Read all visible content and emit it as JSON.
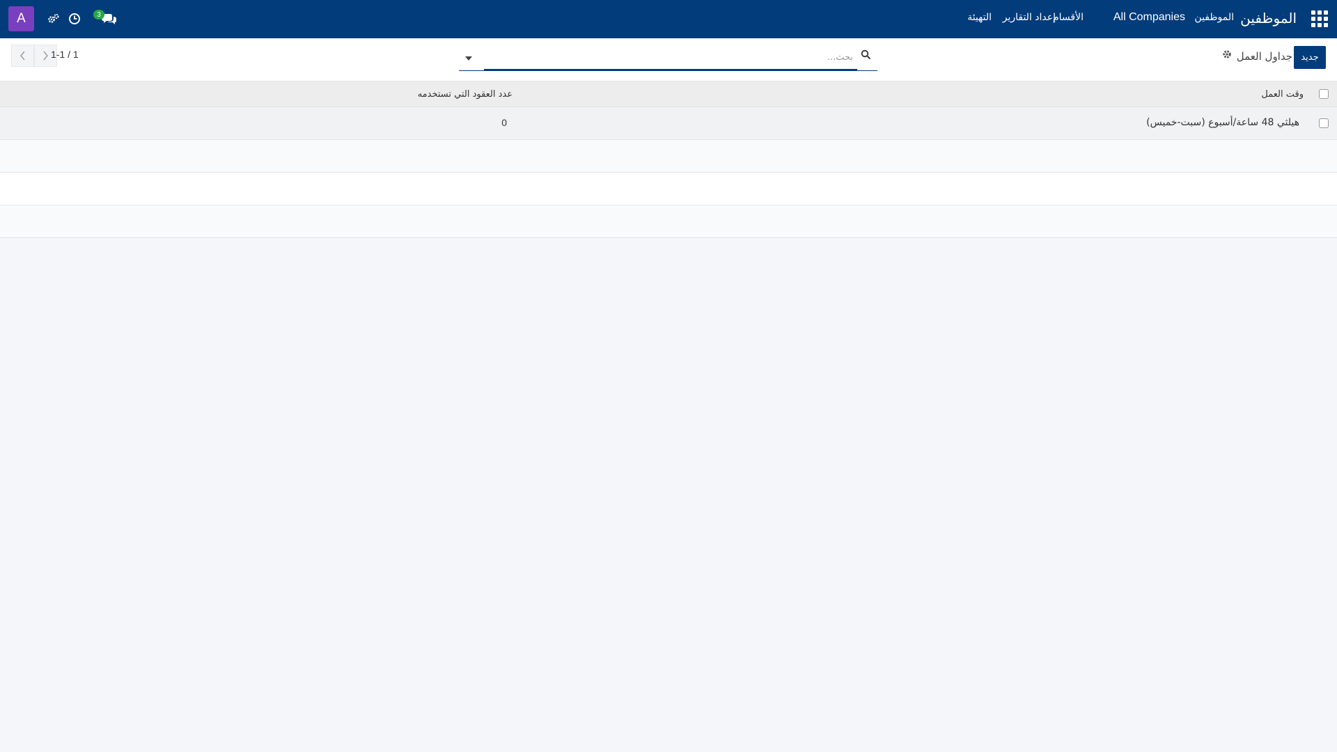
{
  "navbar": {
    "app_title": "الموظفين",
    "menu": [
      "الموظفين",
      "All Companies",
      "الأقسام",
      "إعداد التقارير",
      "التهيئة"
    ],
    "avatar_letter": "A",
    "messages_count": "3",
    "icons": [
      "apps-icon",
      "chat-icon",
      "clock-icon",
      "settings-icon"
    ],
    "background": "#023c7a"
  },
  "control_panel": {
    "new_button_label": "جديد",
    "breadcrumb": "جداول العمل",
    "search": {
      "placeholder": "بحث..."
    },
    "pager": {
      "value": "1-1 / 1"
    }
  },
  "table": {
    "columns": [
      "وقت العمل",
      "عدد العقود التي تستخدمه"
    ],
    "rows": [
      {
        "name": "هيلثي 48 ساعة/أسبوع (سبت-خميس)",
        "contracts_count": "0"
      }
    ]
  }
}
